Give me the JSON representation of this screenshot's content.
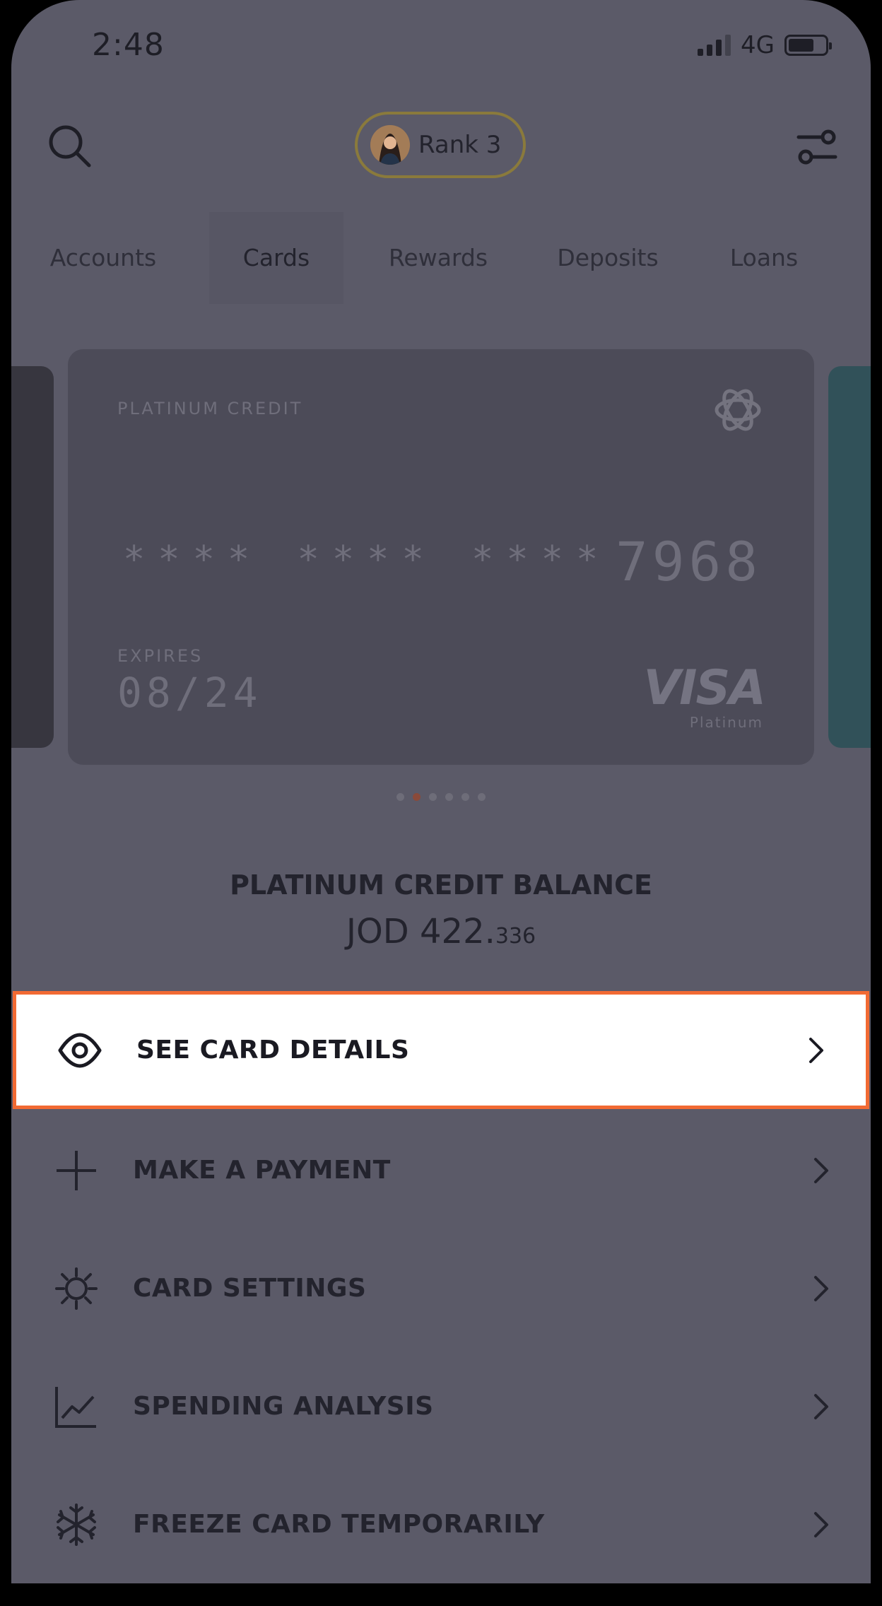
{
  "status_bar": {
    "time": "2:48",
    "network": "4G"
  },
  "header": {
    "rank_label": "Rank 3"
  },
  "tabs": [
    {
      "label": "Accounts"
    },
    {
      "label": "Cards"
    },
    {
      "label": "Rewards"
    },
    {
      "label": "Deposits"
    },
    {
      "label": "Loans"
    }
  ],
  "active_tab": "Cards",
  "card": {
    "type": "PLATINUM CREDIT",
    "masked_number": "**** **** ****",
    "last4": "7968",
    "expires_label": "EXPIRES",
    "expires": "08/24",
    "network": "VISA",
    "network_sub": "Platinum"
  },
  "pager": {
    "count": 6,
    "active_index": 1
  },
  "balance": {
    "title": "PLATINUM CREDIT BALANCE",
    "currency_main": "JOD 422.",
    "decimals": "336"
  },
  "actions": [
    {
      "label": "SEE CARD DETAILS",
      "icon": "eye-icon"
    },
    {
      "label": "MAKE A PAYMENT",
      "icon": "plus-icon"
    },
    {
      "label": "CARD SETTINGS",
      "icon": "gear-icon"
    },
    {
      "label": "SPENDING ANALYSIS",
      "icon": "chart-icon"
    },
    {
      "label": "FREEZE CARD TEMPORARILY",
      "icon": "snowflake-icon"
    }
  ],
  "colors": {
    "overlay": "#5b5a68",
    "highlight_border": "#f26a33"
  }
}
